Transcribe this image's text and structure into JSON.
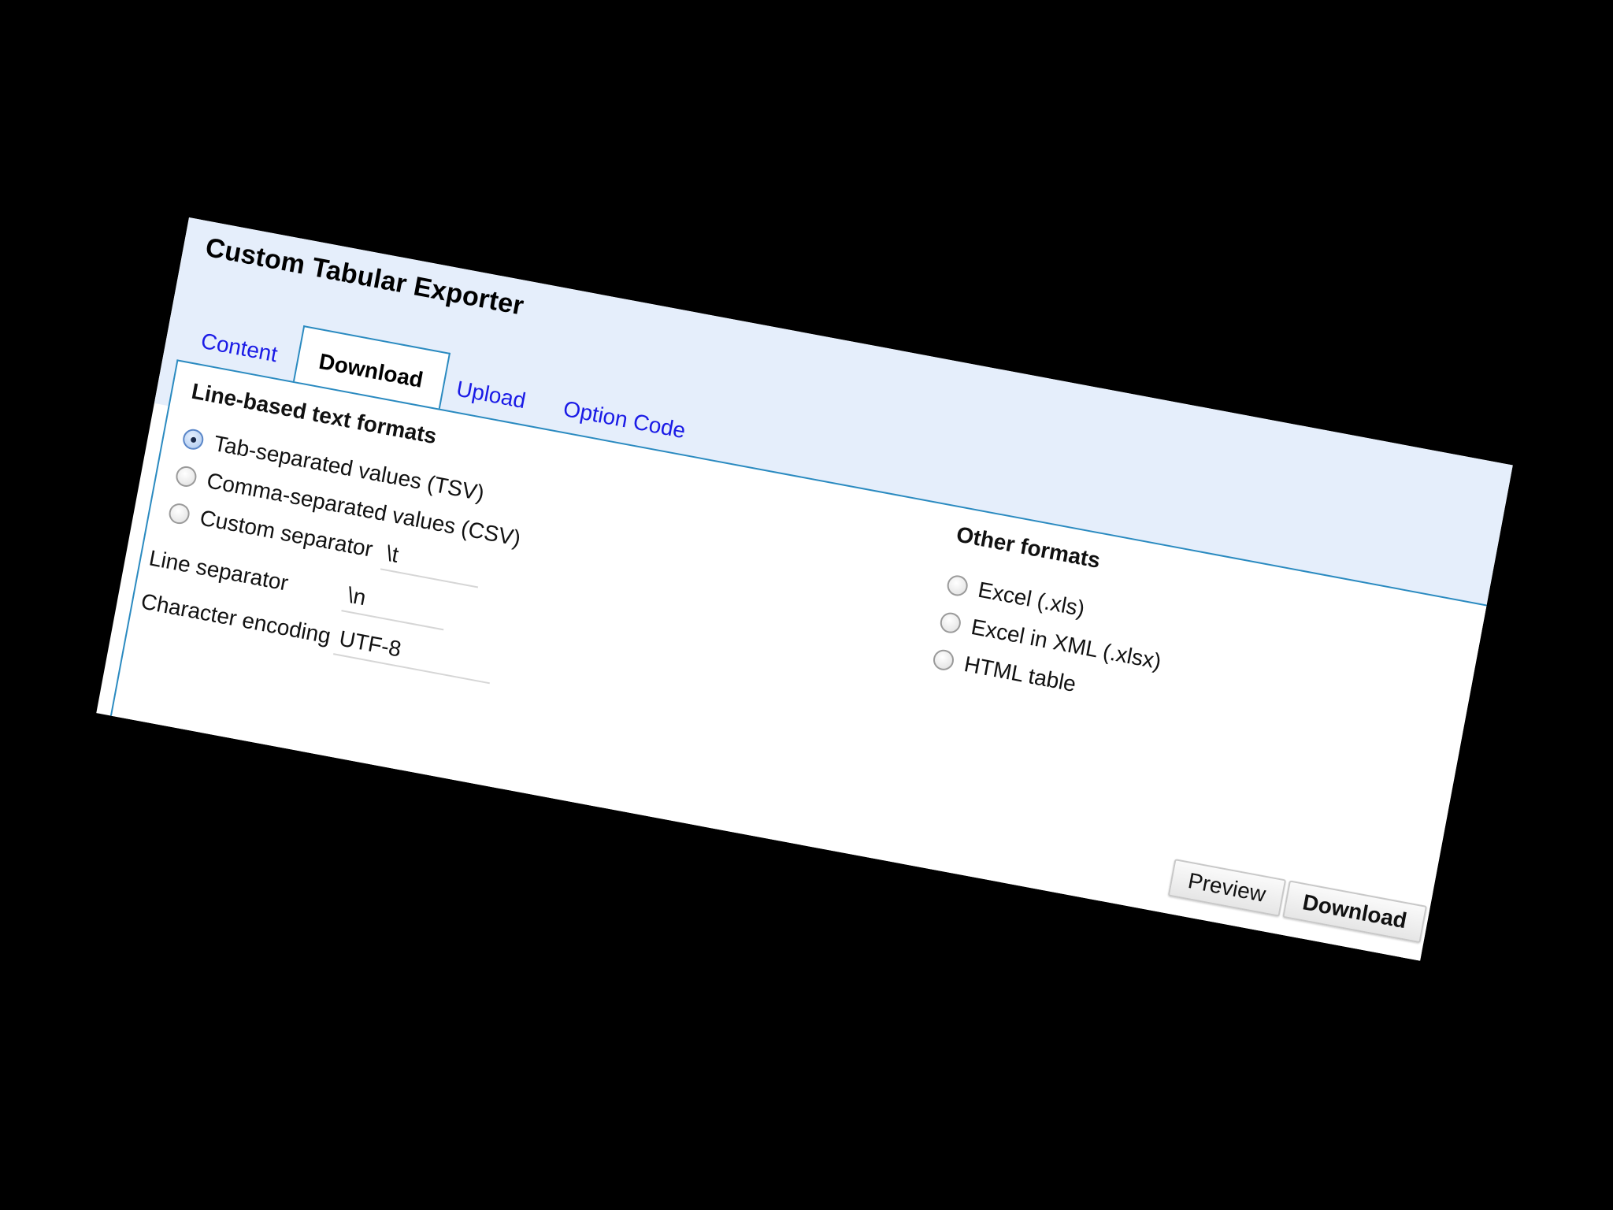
{
  "dialog": {
    "title": "Custom Tabular Exporter"
  },
  "tabs": [
    {
      "label": "Content",
      "active": false
    },
    {
      "label": "Download",
      "active": true
    },
    {
      "label": "Upload",
      "active": false
    },
    {
      "label": "Option Code",
      "active": false
    }
  ],
  "line_based": {
    "title": "Line-based text formats",
    "options": [
      {
        "label": "Tab-separated values (TSV)",
        "checked": true
      },
      {
        "label": "Comma-separated values (CSV)",
        "checked": false
      },
      {
        "label": "Custom separator",
        "checked": false
      }
    ],
    "custom_separator_value": "\\t",
    "line_separator_label": "Line separator",
    "line_separator_value": "\\n",
    "encoding_label": "Character encoding",
    "encoding_value": "UTF-8"
  },
  "other_formats": {
    "title": "Other formats",
    "options": [
      {
        "label": "Excel (.xls)",
        "checked": false
      },
      {
        "label": "Excel in XML (.xlsx)",
        "checked": false
      },
      {
        "label": "HTML table",
        "checked": false
      }
    ]
  },
  "buttons": {
    "preview": "Preview",
    "download": "Download"
  },
  "colors": {
    "background": "#000000",
    "titlebar": "#e5eefb",
    "tab_border": "#2a8ac0",
    "link": "#1a1ae6"
  }
}
